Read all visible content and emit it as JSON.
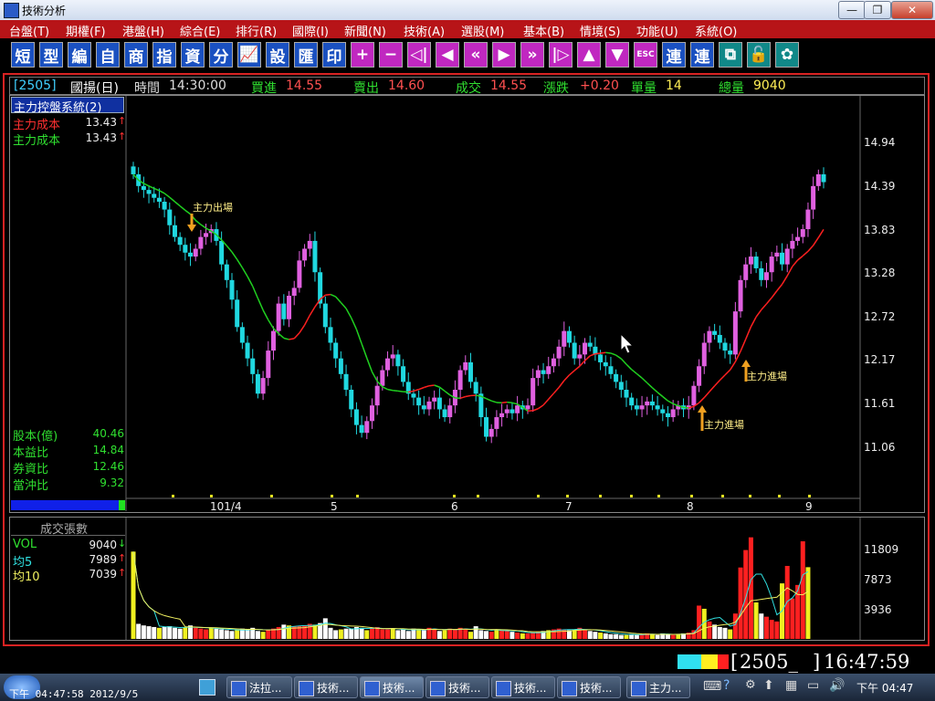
{
  "window": {
    "title": "技術分析",
    "buttons": [
      "—",
      "❐",
      "✕"
    ]
  },
  "menu": [
    "台盤(T)",
    "期權(F)",
    "港盤(H)",
    "綜合(E)",
    "排行(R)",
    "國際(I)",
    "新聞(N)",
    "技術(A)",
    "選股(M)",
    "基本(B)",
    "情境(S)",
    "功能(U)",
    "系統(O)"
  ],
  "toolbar": [
    {
      "label": "短",
      "style": "blue"
    },
    {
      "label": "型",
      "style": "blue"
    },
    {
      "label": "編",
      "style": "blue"
    },
    {
      "label": "自",
      "style": "blue"
    },
    {
      "label": "商",
      "style": "blue"
    },
    {
      "label": "指",
      "style": "blue"
    },
    {
      "label": "資",
      "style": "blue"
    },
    {
      "label": "分",
      "style": "blue"
    },
    {
      "label": "📈",
      "style": "blue"
    },
    {
      "label": "設",
      "style": "blue"
    },
    {
      "label": "匯",
      "style": "blue"
    },
    {
      "label": "印",
      "style": "blue"
    },
    {
      "label": "+",
      "style": "mag"
    },
    {
      "label": "−",
      "style": "mag"
    },
    {
      "label": "◁|",
      "style": "mag"
    },
    {
      "label": "◀",
      "style": "mag"
    },
    {
      "label": "«",
      "style": "mag"
    },
    {
      "label": "▶",
      "style": "mag"
    },
    {
      "label": "»",
      "style": "mag"
    },
    {
      "label": "|▷",
      "style": "mag"
    },
    {
      "label": "▲",
      "style": "mag"
    },
    {
      "label": "▼",
      "style": "mag"
    },
    {
      "label": "ESC",
      "style": "mag"
    },
    {
      "label": "連",
      "style": "blue"
    },
    {
      "label": "連",
      "style": "blue"
    },
    {
      "label": "⧉",
      "style": "teal"
    },
    {
      "label": "🔓",
      "style": "teal"
    },
    {
      "label": "✿",
      "style": "teal"
    }
  ],
  "quote": {
    "code": "[2505]",
    "name": "國揚(日)",
    "time_label": "時間",
    "time": "14:30:00",
    "bid_label": "買進",
    "bid": "14.55",
    "ask_label": "賣出",
    "ask": "14.60",
    "deal_label": "成交",
    "deal": "14.55",
    "change_label": "漲跌",
    "change": "+0.20",
    "unit_label": "單量",
    "unit": "14",
    "total_label": "總量",
    "total": "9040"
  },
  "indicator": {
    "title": "主力控盤系統(2)",
    "rows": [
      {
        "label": "主力成本",
        "value": "13.43",
        "arrow": "↑",
        "color": "#ff3030"
      },
      {
        "label": "主力成本",
        "value": "13.43",
        "arrow": "↑",
        "color": "#30e030"
      }
    ]
  },
  "fundamentals": [
    {
      "label": "股本(億)",
      "value": "40.46"
    },
    {
      "label": "本益比",
      "value": "14.84"
    },
    {
      "label": "券資比",
      "value": "12.46"
    },
    {
      "label": "當沖比",
      "value": "9.32"
    }
  ],
  "annotations": {
    "exit": "主力出場",
    "enter1": "主力進場",
    "enter2": "主力進場"
  },
  "volume_panel": {
    "title": "成交張數",
    "rows": [
      {
        "label": "VOL",
        "value": "9040",
        "arrow": "↓",
        "color": "#30e030"
      },
      {
        "label": "均5",
        "value": "7989",
        "arrow": "↑",
        "color": "#30e0e0"
      },
      {
        "label": "均10",
        "value": "7039",
        "arrow": "↑",
        "color": "#f0f060"
      }
    ],
    "yticks": [
      "11809",
      "7873",
      "3936"
    ]
  },
  "chart_data": {
    "type": "candlestick",
    "price_yticks": [
      "14.94",
      "14.39",
      "13.83",
      "13.28",
      "12.72",
      "12.17",
      "11.61",
      "11.06"
    ],
    "ylim": [
      10.6,
      15.4
    ],
    "xticks": [
      "101/4",
      "5",
      "6",
      "7",
      "8",
      "9"
    ],
    "cost_ma_last": 13.43,
    "closes": [
      14.55,
      14.4,
      14.35,
      14.3,
      14.25,
      14.2,
      14.1,
      13.9,
      13.75,
      13.65,
      13.55,
      13.5,
      13.6,
      13.75,
      13.8,
      13.85,
      13.7,
      13.4,
      13.2,
      12.95,
      12.6,
      12.4,
      12.2,
      12.0,
      11.75,
      11.95,
      12.3,
      12.55,
      12.9,
      12.7,
      13.0,
      13.1,
      13.45,
      13.6,
      13.7,
      13.3,
      12.9,
      12.6,
      12.4,
      12.2,
      12.0,
      11.8,
      11.55,
      11.35,
      11.25,
      11.4,
      11.6,
      11.85,
      12.05,
      12.2,
      12.25,
      12.1,
      11.9,
      11.75,
      11.7,
      11.6,
      11.55,
      11.65,
      11.7,
      11.55,
      11.45,
      11.6,
      11.8,
      12.05,
      12.15,
      11.9,
      11.75,
      11.45,
      11.2,
      11.3,
      11.45,
      11.5,
      11.55,
      11.5,
      11.6,
      11.55,
      11.6,
      11.95,
      12.05,
      12.0,
      12.1,
      12.2,
      12.35,
      12.55,
      12.4,
      12.2,
      12.25,
      12.4,
      12.35,
      12.25,
      12.15,
      12.1,
      12.0,
      11.9,
      11.8,
      11.7,
      11.6,
      11.55,
      11.6,
      11.65,
      11.6,
      11.55,
      11.5,
      11.45,
      11.55,
      11.6,
      11.55,
      11.6,
      11.85,
      12.1,
      12.4,
      12.55,
      12.5,
      12.4,
      12.3,
      12.25,
      12.8,
      13.2,
      13.4,
      13.5,
      13.35,
      13.2,
      13.3,
      13.5,
      13.55,
      13.4,
      13.6,
      13.7,
      13.75,
      13.85,
      14.1,
      14.4,
      14.55,
      14.45
    ],
    "volumes": [
      11000,
      1900,
      1700,
      1600,
      1500,
      1400,
      1500,
      1600,
      1400,
      1300,
      1500,
      1700,
      1400,
      1300,
      1200,
      1400,
      1300,
      1200,
      1100,
      1000,
      1100,
      1300,
      1200,
      1400,
      1000,
      900,
      1200,
      1300,
      1500,
      1800,
      1700,
      1600,
      1600,
      1700,
      1900,
      1800,
      2000,
      2600,
      1400,
      1100,
      1200,
      1300,
      1300,
      1500,
      1400,
      1100,
      1400,
      1500,
      1200,
      1200,
      1300,
      1100,
      1200,
      1000,
      1300,
      1200,
      1100,
      1400,
      1300,
      1000,
      1100,
      1300,
      1200,
      1400,
      1300,
      900,
      1600,
      1100,
      1000,
      900,
      1200,
      1100,
      1000,
      900,
      800,
      700,
      700,
      800,
      900,
      1000,
      1100,
      1200,
      1300,
      1200,
      1100,
      1200,
      1400,
      1100,
      1000,
      900,
      800,
      700,
      600,
      600,
      500,
      500,
      600,
      500,
      600,
      700,
      600,
      500,
      700,
      600,
      500,
      600,
      700,
      800,
      1100,
      4200,
      3800,
      2200,
      1800,
      1500,
      1400,
      1200,
      3200,
      9000,
      11200,
      12800,
      4600,
      3200,
      2800,
      2400,
      2200,
      7000,
      9200,
      5100,
      6800,
      12300,
      9040
    ]
  },
  "status": {
    "symbol": "2505_",
    "clock": "16:47:59"
  },
  "taskbar": {
    "left_clock": "下午 04:47:58 2012/9/5",
    "tasks": [
      "法拉...",
      "技術...",
      "技術...",
      "技術...",
      "技術...",
      "技術...",
      "主力..."
    ],
    "tray_time": "下午 04:47"
  }
}
